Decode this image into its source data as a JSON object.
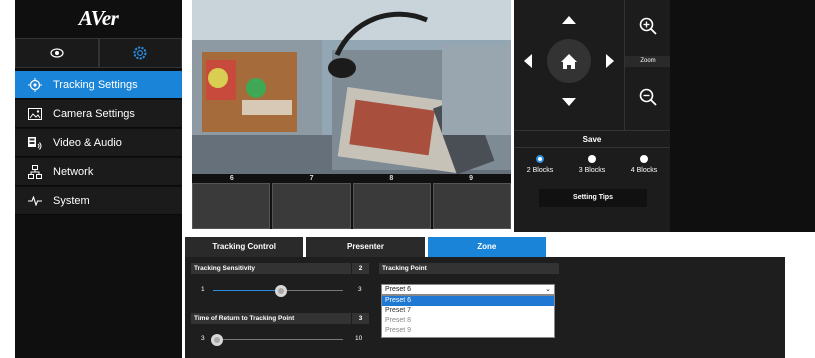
{
  "brand": {
    "logo": "AVer"
  },
  "sidebar": {
    "items": [
      {
        "label": "Tracking Settings",
        "icon": "crosshair-icon",
        "active": true
      },
      {
        "label": "Camera Settings",
        "icon": "image-icon",
        "active": false
      },
      {
        "label": "Video & Audio",
        "icon": "speaker-icon",
        "active": false
      },
      {
        "label": "Network",
        "icon": "network-icon",
        "active": false
      },
      {
        "label": "System",
        "icon": "pulse-icon",
        "active": false
      }
    ]
  },
  "presets": {
    "labels": [
      "6",
      "7",
      "8",
      "9"
    ]
  },
  "ptz": {
    "zoom_label": "Zoom",
    "save_label": "Save",
    "blocks": [
      "2 Blocks",
      "3 Blocks",
      "4 Blocks"
    ],
    "selected_block": 0,
    "setting_tips": "Setting Tips"
  },
  "tabs": [
    {
      "label": "Tracking Control",
      "active": false
    },
    {
      "label": "Presenter",
      "active": false
    },
    {
      "label": "Zone",
      "active": true
    }
  ],
  "tracking": {
    "sensitivity": {
      "label": "Tracking Sensitivity",
      "value": "2",
      "min": "1",
      "max": "3"
    },
    "return_time": {
      "label": "Time of Return to Tracking Point",
      "value": "3",
      "min": "3",
      "max": "10"
    },
    "tracking_point": {
      "label": "Tracking Point",
      "selected": "Preset 6",
      "options": [
        "Preset 6",
        "Preset 7",
        "Preset 8",
        "Preset 9"
      ]
    }
  },
  "colors": {
    "accent": "#1a84d8",
    "sidebar": "#0f0f0f",
    "panel": "#1e1e1e"
  }
}
